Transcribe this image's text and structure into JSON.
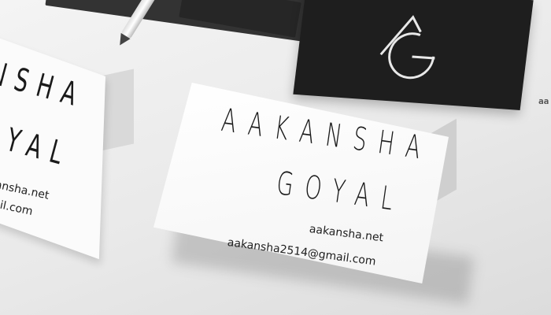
{
  "background_color": "#ebebeb",
  "logo_card": {
    "monogram_icon": "ag-monogram-logo",
    "color": "#1e1e1e"
  },
  "main_card": {
    "name_first": "AAKANSHA",
    "name_last": "GOYAL",
    "website": "aakansha.net",
    "email": "aakansha2514@gmail.com"
  },
  "left_card": {
    "name_first_partial": "NSHA",
    "name_last_partial": "YAL",
    "website_partial": "kansha.net",
    "email_partial": "mail.com"
  },
  "edge_text": "aa"
}
